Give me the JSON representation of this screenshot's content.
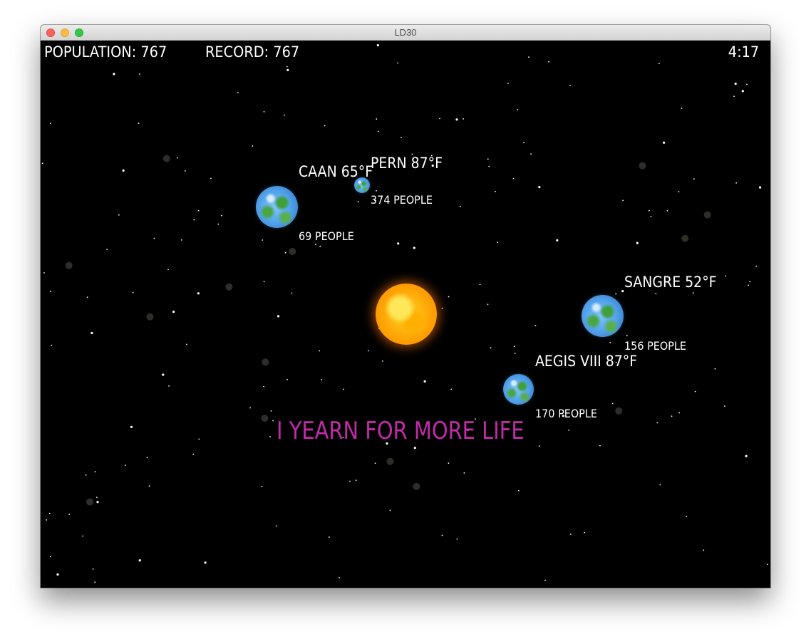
{
  "window": {
    "title": "LD30"
  },
  "hud": {
    "population": "POPULATION: 767",
    "record": "RECORD: 767",
    "time": "4:17"
  },
  "planets": [
    {
      "name": "CAAN 65°F",
      "people": "69 PEOPLE"
    },
    {
      "name": "PERN 87°F",
      "people": "374 PEOPLE"
    },
    {
      "name": "SANGRE 52°F",
      "people": "156 PEOPLE"
    },
    {
      "name": "AEGIS VIII 87°F",
      "people": "170 PEOPLE"
    }
  ],
  "message": "I YEARN FOR MORE LIFE",
  "colors": {
    "message": "#c22aa8",
    "background": "#000000",
    "text": "#ffffff"
  }
}
